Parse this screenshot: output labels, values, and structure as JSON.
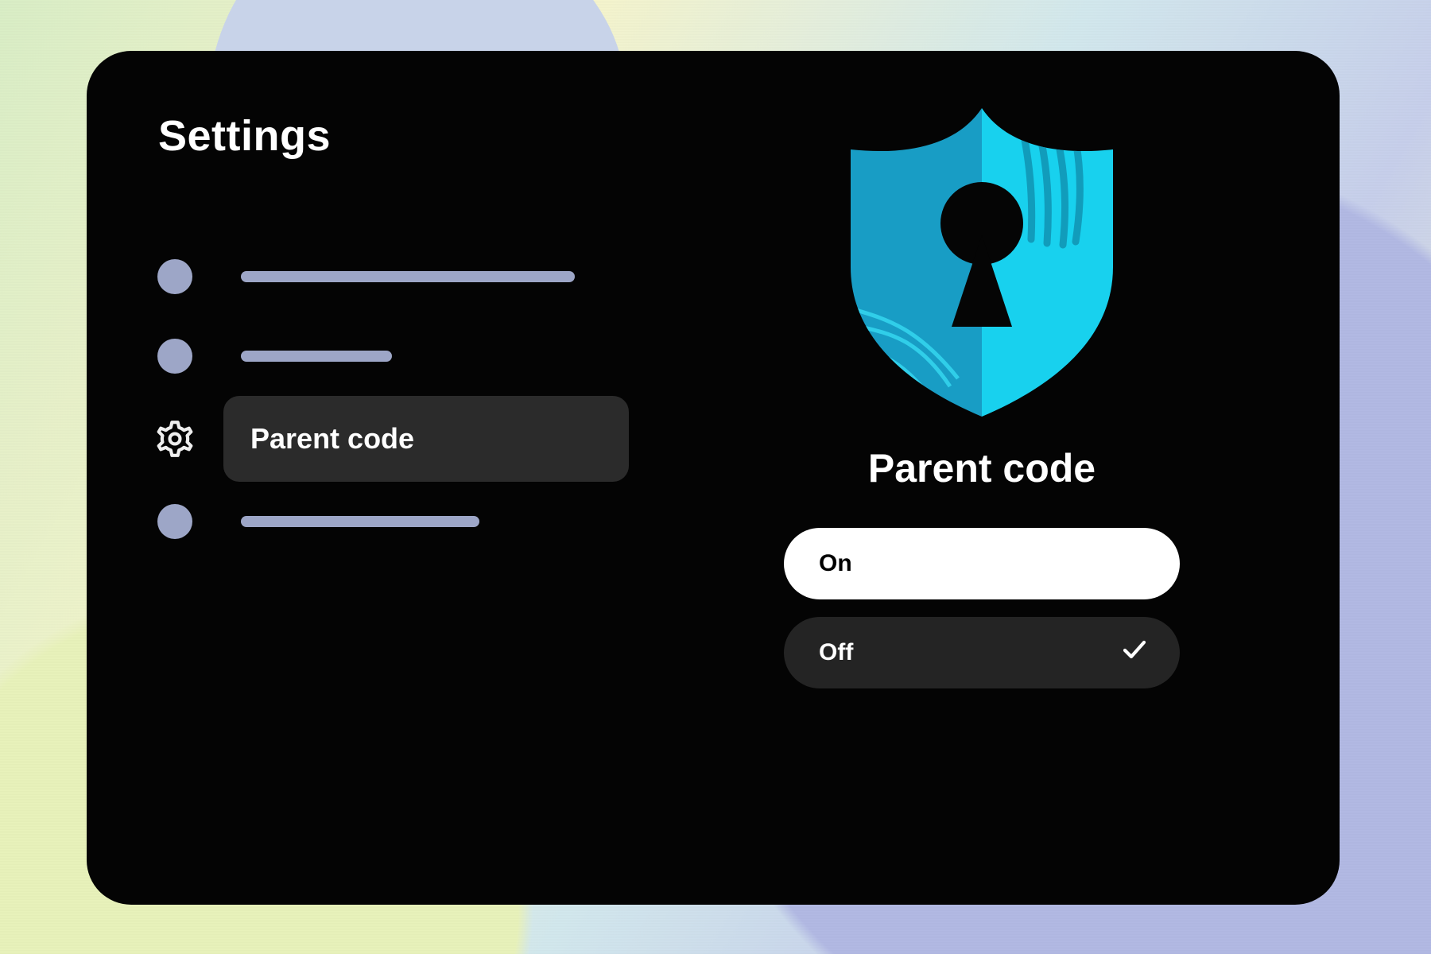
{
  "page": {
    "title": "Settings"
  },
  "nav": {
    "selected_label": "Parent code"
  },
  "panel": {
    "title": "Parent code",
    "options": {
      "on": {
        "label": "On",
        "selected": false,
        "focused": true
      },
      "off": {
        "label": "Off",
        "selected": true,
        "focused": false
      }
    }
  },
  "colors": {
    "shield_left": "#189dc5",
    "shield_right": "#18d1ee",
    "nav_placeholder": "#9da6c7"
  }
}
